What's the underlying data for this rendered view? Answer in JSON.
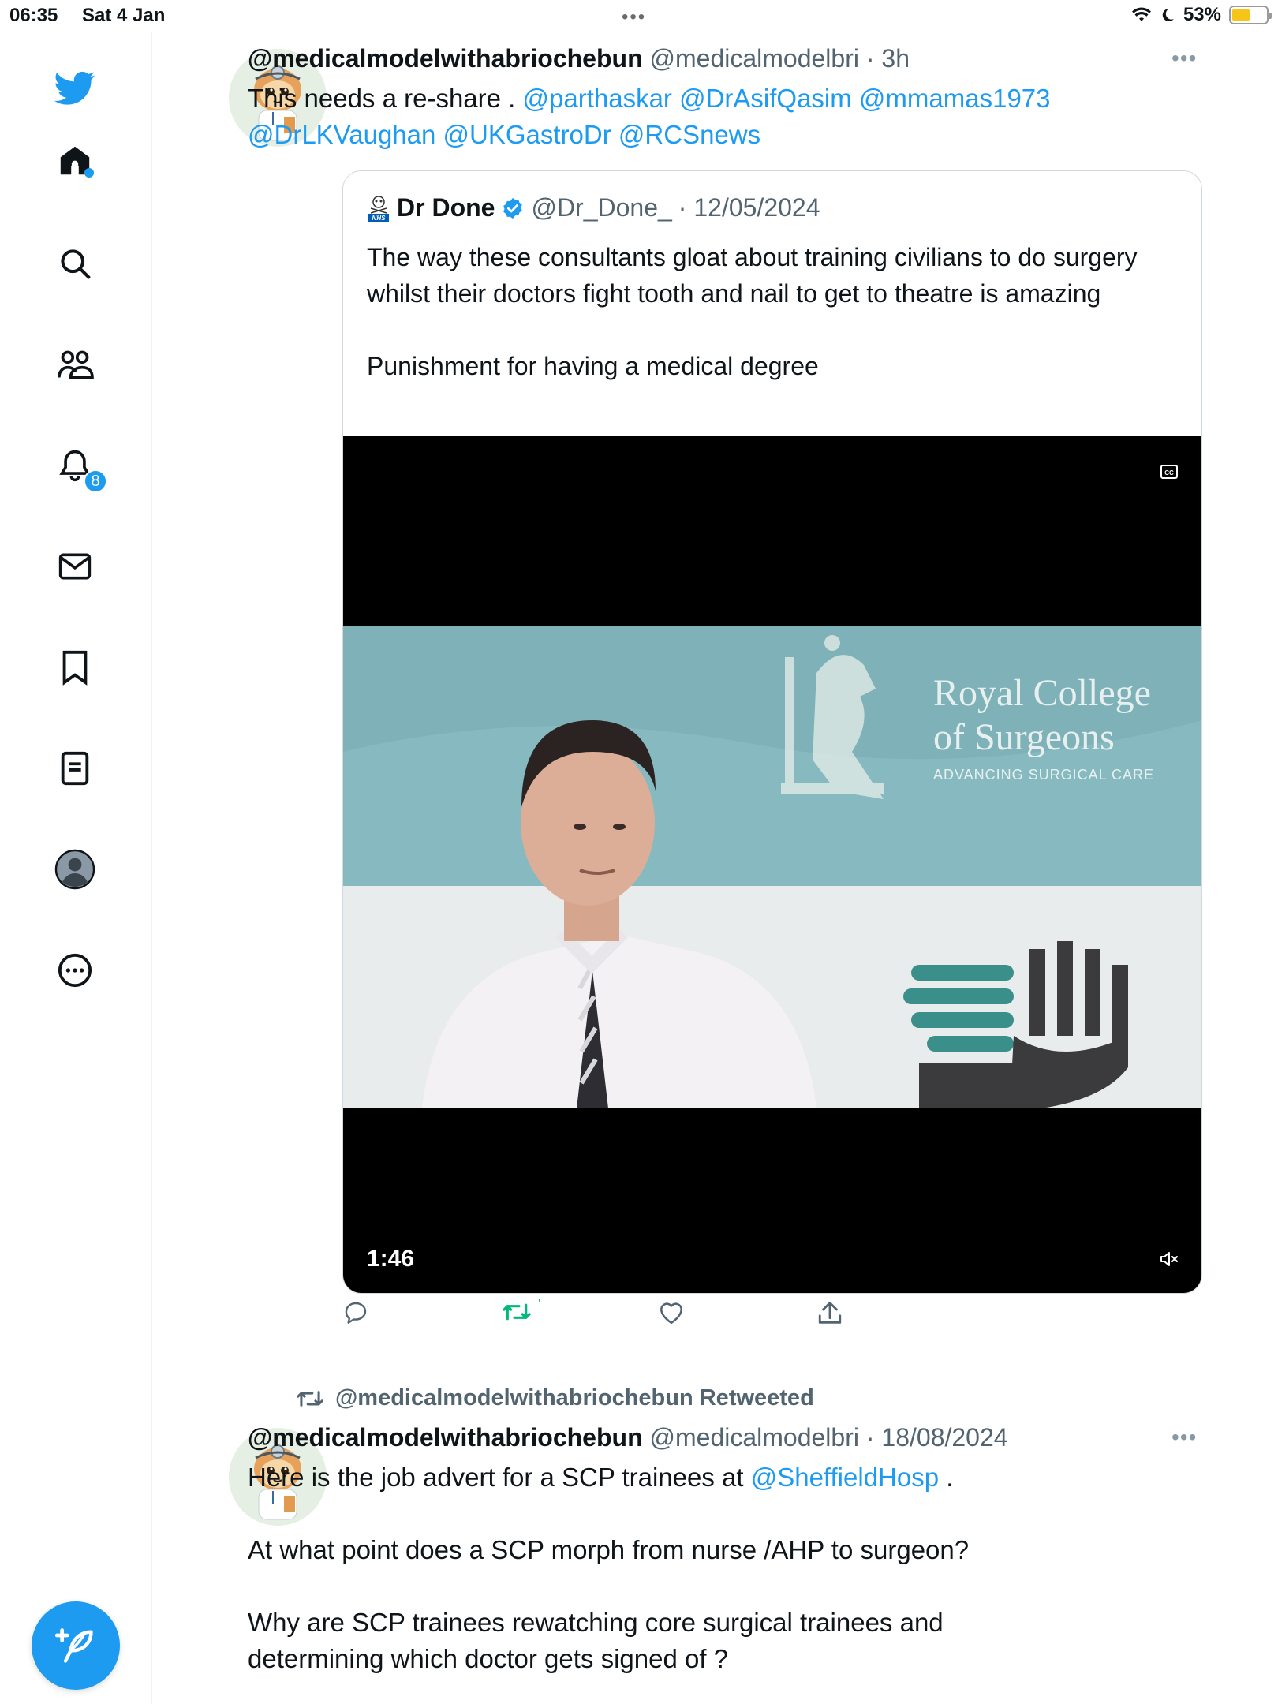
{
  "status_bar": {
    "time": "06:35",
    "date": "Sat 4 Jan",
    "dots": "•••",
    "battery": "53%",
    "battery_level": 0.53
  },
  "sidebar": {
    "items": [
      "twitter-logo",
      "home",
      "search",
      "communities",
      "notifications",
      "messages",
      "bookmarks",
      "lists",
      "profile",
      "more"
    ],
    "notification_count": "8"
  },
  "tweet1": {
    "display_name": "@medicalmodelwithabriochebun",
    "handle": "@medicalmodelbri",
    "time": "· 3h",
    "text_plain": "This needs a re-share . ",
    "mentions_line1": "@parthaskar @DrAsifQasim @mmamas1973",
    "mentions_line2": "@DrLKVaughan @UKGastroDr @RCSnews",
    "more": "•••",
    "quote": {
      "display_name": "Dr Done",
      "handle": "@Dr_Done_",
      "date": "· 12/05/2024",
      "text_p1": "The way these consultants gloat about training civilians to do surgery whilst their doctors fight tooth and nail to get to theatre is amazing",
      "text_p2": "Punishment for having a medical degree",
      "video": {
        "duration": "1:46",
        "logo_line1": "Royal College",
        "logo_line2": "of Surgeons",
        "logo_tagline": "ADVANCING SURGICAL CARE"
      }
    },
    "actions": {
      "retweet_count": "'"
    }
  },
  "retweet_label": "@medicalmodelwithabriochebun Retweeted",
  "tweet2": {
    "display_name": "@medicalmodelwithabriochebun",
    "handle": "@medicalmodelbri",
    "date": "· 18/08/2024",
    "more": "•••",
    "text_l1_pre": "Here is the job advert for a SCP trainees  at ",
    "text_l1_mention": "@SheffieldHosp",
    "text_l1_post": " .",
    "text_p2": "At what point does a SCP morph from nurse /AHP to surgeon?",
    "text_p3": "Why are SCP trainees rewatching core surgical trainees and determining which doctor gets signed of ?"
  },
  "colors": {
    "accent": "#1d9bf0",
    "retweet_green": "#00ba7c",
    "text": "#0f1419",
    "secondary": "#536471"
  }
}
